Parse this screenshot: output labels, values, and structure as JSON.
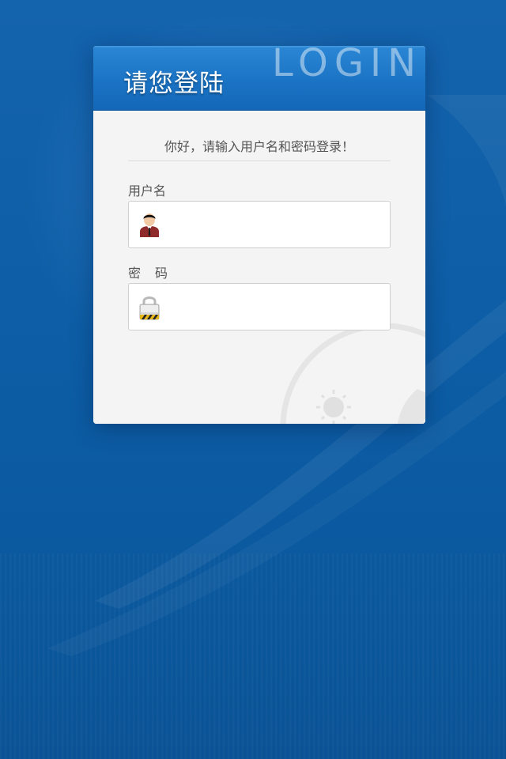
{
  "header": {
    "title": "请您登陆",
    "watermark": "LOGIN"
  },
  "form": {
    "greeting": "你好，请输入用户名和密码登录！",
    "username_label": "用户名",
    "username_value": "",
    "username_icon": "user-avatar-icon",
    "password_label": "密码",
    "password_value": "",
    "password_icon": "padlock-icon"
  },
  "colors": {
    "background": "#0b5aa1",
    "header": "#1b73c4",
    "card": "#f4f4f4",
    "text": "#555555"
  }
}
